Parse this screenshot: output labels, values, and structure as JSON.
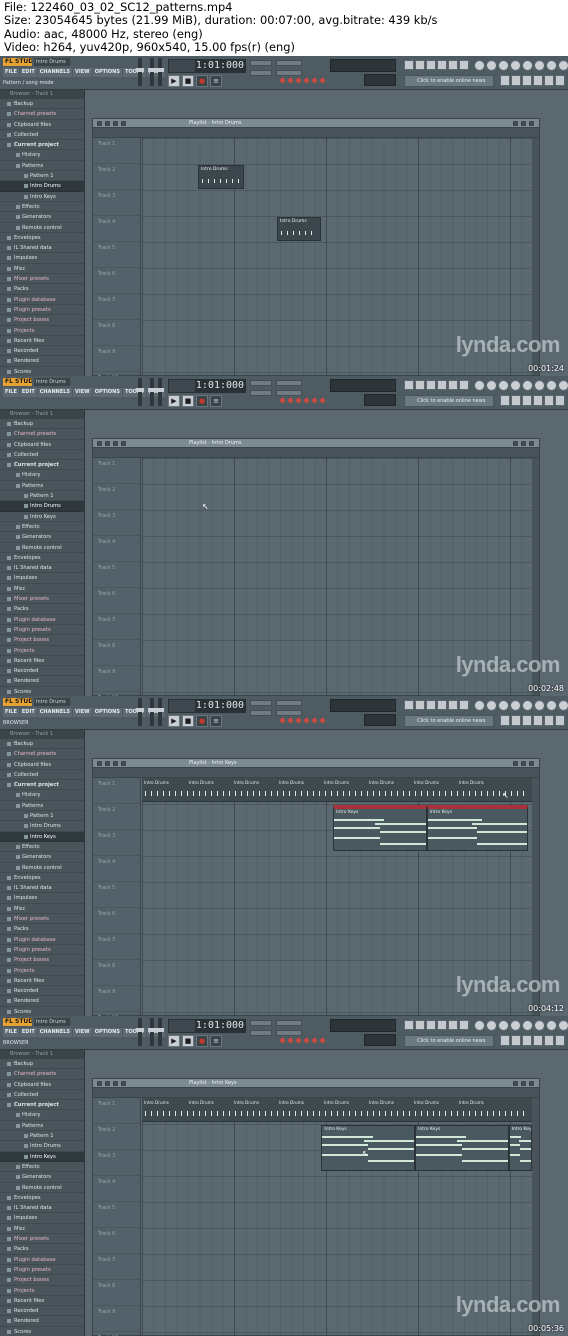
{
  "header": {
    "line1": "File: 122460_03_02_SC12_patterns.mp4",
    "line2": "Size: 23054645 bytes (21.99 MiB), duration: 00:07:00, avg.bitrate: 439 kb/s",
    "line3": "Audio: aac, 48000 Hz, stereo (eng)",
    "line4": "Video: h264, yuv420p, 960x540, 15.00 fps(r) (eng)"
  },
  "app": {
    "logo": "FL STUDIO",
    "file_name": "Intro Drums",
    "menu": [
      "FILE",
      "EDIT",
      "CHANNELS",
      "VIEW",
      "OPTIONS",
      "TOOLS",
      "HELP"
    ],
    "time_display": "1:01:000",
    "hint_bar": "Click to enable online news",
    "play_icons": [
      "▶",
      "■",
      "●",
      "≡"
    ],
    "icon_names": {
      "logo": "fl-studio-logo",
      "play": "play-icon",
      "stop": "stop-icon",
      "record": "record-icon",
      "news": "news-icon"
    }
  },
  "browser": {
    "header": "Browser - Track 1",
    "items": [
      {
        "label": "Backup",
        "level": 0,
        "pink": false
      },
      {
        "label": "Channel presets",
        "level": 0,
        "pink": true
      },
      {
        "label": "Clipboard files",
        "level": 0,
        "pink": false
      },
      {
        "label": "Collected",
        "level": 0,
        "pink": false
      },
      {
        "label": "Current project",
        "level": 0,
        "pink": false,
        "bold": true
      },
      {
        "label": "History",
        "level": 1,
        "pink": false
      },
      {
        "label": "Patterns",
        "level": 1,
        "pink": false
      },
      {
        "label": "Pattern 1",
        "level": 2,
        "pink": false
      },
      {
        "label": "Intro Drums",
        "level": 2,
        "pink": false
      },
      {
        "label": "Intro Keys",
        "level": 2,
        "pink": false
      },
      {
        "label": "Effects",
        "level": 1,
        "pink": false
      },
      {
        "label": "Generators",
        "level": 1,
        "pink": false
      },
      {
        "label": "Remote control",
        "level": 1,
        "pink": false
      },
      {
        "label": "Envelopes",
        "level": 0,
        "pink": false
      },
      {
        "label": "IL Shared data",
        "level": 0,
        "pink": false
      },
      {
        "label": "Impulses",
        "level": 0,
        "pink": false
      },
      {
        "label": "Misc",
        "level": 0,
        "pink": false
      },
      {
        "label": "Mixer presets",
        "level": 0,
        "pink": true
      },
      {
        "label": "Packs",
        "level": 0,
        "pink": false
      },
      {
        "label": "Plugin database",
        "level": 0,
        "pink": true
      },
      {
        "label": "Plugin presets",
        "level": 0,
        "pink": true
      },
      {
        "label": "Project bones",
        "level": 0,
        "pink": true
      },
      {
        "label": "Projects",
        "level": 0,
        "pink": true
      },
      {
        "label": "Recent files",
        "level": 0,
        "pink": false
      },
      {
        "label": "Recorded",
        "level": 0,
        "pink": false
      },
      {
        "label": "Rendered",
        "level": 0,
        "pink": false
      },
      {
        "label": "Scores",
        "level": 0,
        "pink": false
      }
    ]
  },
  "tracks": [
    "Track 1",
    "Track 2",
    "Track 3",
    "Track 4",
    "Track 5",
    "Track 6",
    "Track 7",
    "Track 8",
    "Track 9",
    "Track 10"
  ],
  "watermark": "lynda.com",
  "frames": [
    {
      "timestamp": "00:01:24",
      "status_hint": "Pattern / song mode",
      "playlist_title": "Playlist - Intro Drums",
      "selected_browser_item": "Intro Drums",
      "clips": [
        {
          "name": "Intro Drums",
          "track": 2
        },
        {
          "name": "Intro Drums",
          "track": 4
        }
      ],
      "drum_row": false,
      "keys_clips": []
    },
    {
      "timestamp": "00:02:48",
      "status_hint": "",
      "playlist_title": "Playlist - Intro Drums",
      "selected_browser_item": "Intro Drums",
      "clips": [],
      "drum_row": false,
      "keys_clips": []
    },
    {
      "timestamp": "00:04:12",
      "status_hint": "BROWSER",
      "playlist_title": "Playlist - Intro Keys",
      "selected_browser_item": "Intro Keys",
      "clips": [],
      "drum_row": true,
      "drum_labels": [
        "Intro Drums",
        "Intro Drums",
        "Intro Drums",
        "Intro Drums",
        "Intro Drums",
        "Intro Drums",
        "Intro Drums",
        "Intro Drums"
      ],
      "keys_clips": [
        {
          "name": "Intro Keys",
          "start": 0.49,
          "span": 0.24,
          "highlight": true
        },
        {
          "name": "Intro Keys",
          "start": 0.73,
          "span": 0.26,
          "highlight": true
        }
      ]
    },
    {
      "timestamp": "00:05:36",
      "status_hint": "BROWSER",
      "playlist_title": "Playlist - Intro Keys",
      "selected_browser_item": "Intro Keys",
      "clips": [],
      "drum_row": true,
      "drum_labels": [
        "Intro Drums",
        "Intro Drums",
        "Intro Drums",
        "Intro Drums",
        "Intro Drums",
        "Intro Drums",
        "Intro Drums",
        "Intro Drums"
      ],
      "keys_clips": [
        {
          "name": "Intro Keys",
          "start": 0.46,
          "span": 0.24,
          "highlight": false
        },
        {
          "name": "Intro Keys",
          "start": 0.7,
          "span": 0.24,
          "highlight": false
        },
        {
          "name": "Intro Keys",
          "start": 0.94,
          "span": 0.06,
          "highlight": false
        }
      ]
    }
  ]
}
